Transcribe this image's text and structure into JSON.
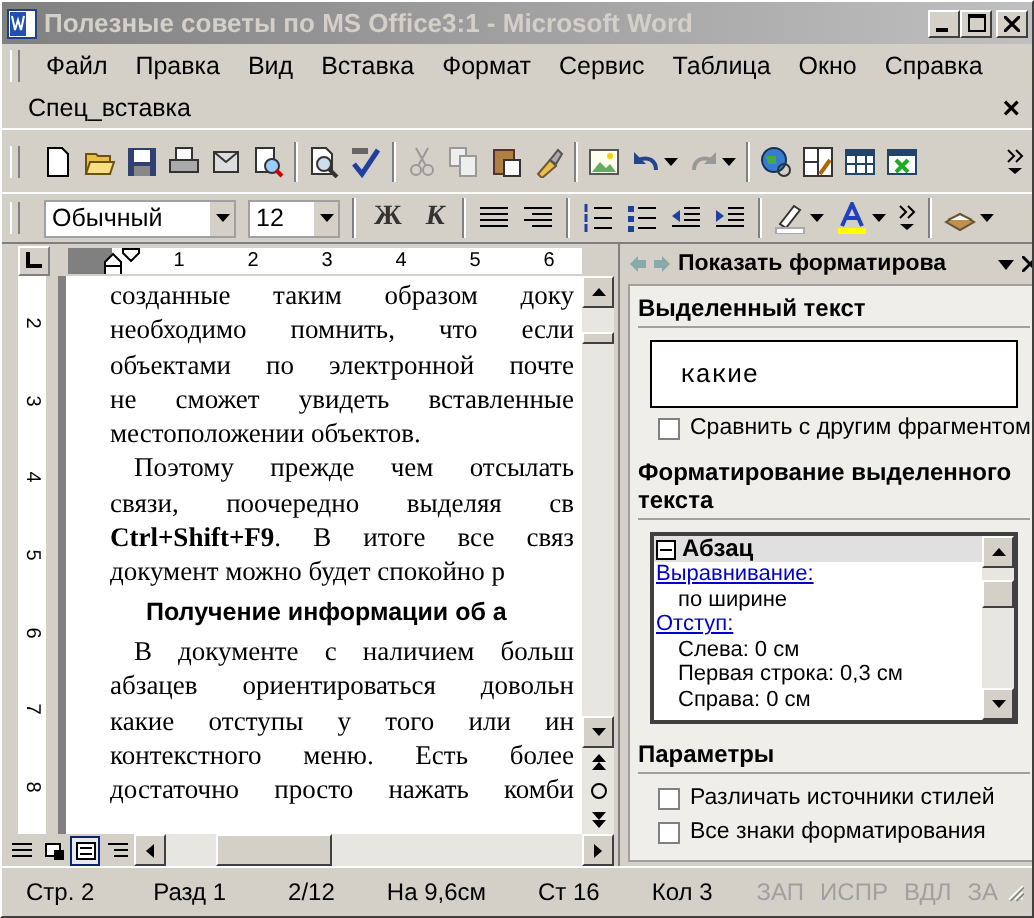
{
  "window": {
    "title": "Полезные советы по MS Office3:1 - Microsoft Word"
  },
  "menu": [
    {
      "label": "Файл"
    },
    {
      "label": "Правка"
    },
    {
      "label": "Вид"
    },
    {
      "label": "Вставка"
    },
    {
      "label": "Формат"
    },
    {
      "label": "Сервис"
    },
    {
      "label": "Таблица"
    },
    {
      "label": "Окно"
    },
    {
      "label": "Справка"
    }
  ],
  "special_toolbar": {
    "title": "Спец_вставка",
    "close": "×"
  },
  "formatting": {
    "style": "Обычный",
    "size": "12",
    "bold": "Ж",
    "italic": "К"
  },
  "ruler_numbers": [
    "1",
    "2",
    "3",
    "4",
    "5",
    "6"
  ],
  "vertical_ruler_numbers": [
    "2",
    "3",
    "4",
    "5",
    "6",
    "7",
    "8"
  ],
  "document": {
    "lines": [
      {
        "kind": "justify",
        "text": "созданные таким образом доку"
      },
      {
        "kind": "justify",
        "text": "необходимо помнить, что если"
      },
      {
        "kind": "justify",
        "text": "объектами по электронной почте"
      },
      {
        "kind": "justify",
        "text": "не сможет увидеть вставленные"
      },
      {
        "kind": "plain",
        "text": "местоположении объектов."
      },
      {
        "kind": "indent",
        "text": "Поэтому прежде чем отсылать"
      },
      {
        "kind": "justify",
        "text": "связи, поочередно выделяя св"
      },
      {
        "kind": "justify",
        "text": "**Ctrl+Shift+F9**. В итоге все связ"
      },
      {
        "kind": "plain",
        "text": "документ можно будет спокойно р"
      },
      {
        "kind": "heading",
        "text": "Получение информации об а"
      },
      {
        "kind": "indent",
        "text": "В документе с наличием больш"
      },
      {
        "kind": "justify",
        "text": "абзацев ориентироваться довольн"
      },
      {
        "kind": "justify",
        "text": "какие отступы у того или ин"
      },
      {
        "kind": "justify",
        "text": "контекстного меню. Есть более"
      },
      {
        "kind": "justify",
        "text": "достаточно просто нажать комби"
      }
    ]
  },
  "view_modes": [
    {
      "selected": false
    },
    {
      "selected": false
    },
    {
      "selected": true
    },
    {
      "selected": false
    }
  ],
  "task_pane": {
    "title": "Показать форматирова",
    "selected_heading": "Выделенный текст",
    "selected_text": "какие",
    "compare": {
      "label": "Сравнить с другим фрагментом",
      "checked": false
    },
    "format_heading": "Форматирование выделенного текста",
    "tree": {
      "label": "Абзац",
      "expanded": true,
      "children": [
        {
          "kind": "link",
          "text": "Выравнивание:"
        },
        {
          "kind": "value",
          "text": "по ширине"
        },
        {
          "kind": "link",
          "text": "Отступ:"
        },
        {
          "kind": "value",
          "text": "Слева:  0 см"
        },
        {
          "kind": "value",
          "text": "Первая строка:  0,3 см"
        },
        {
          "kind": "value",
          "text": "Справа:  0 см"
        }
      ]
    },
    "options_heading": "Параметры",
    "options": [
      {
        "label": "Различать источники стилей",
        "checked": false
      },
      {
        "label": "Все знаки форматирования",
        "checked": false
      }
    ]
  },
  "status_bar": [
    {
      "text": "Стр. 2",
      "disabled": false
    },
    {
      "text": "Разд 1",
      "disabled": false
    },
    {
      "text": "2/12",
      "disabled": false
    },
    {
      "text": "На 9,6см",
      "disabled": false
    },
    {
      "text": "Ст 16",
      "disabled": false
    },
    {
      "text": "Кол 3",
      "disabled": false
    },
    {
      "text": "ЗАП",
      "disabled": true
    },
    {
      "text": "ИСПР",
      "disabled": true
    },
    {
      "text": "ВДЛ",
      "disabled": true
    },
    {
      "text": "ЗА",
      "disabled": true
    }
  ]
}
